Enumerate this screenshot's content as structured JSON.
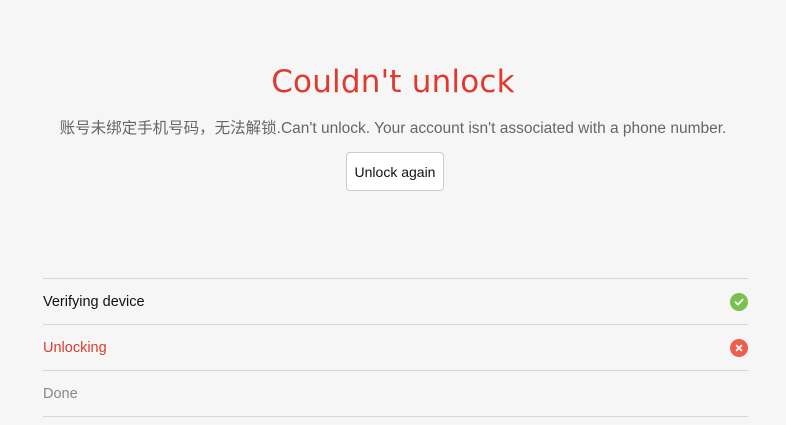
{
  "title": "Couldn't unlock",
  "message": "账号未绑定手机号码，无法解锁.Can't unlock. Your account isn't associated with a phone number.",
  "unlock_again_label": "Unlock again",
  "steps": [
    {
      "label": "Verifying device",
      "status": "success",
      "icon": "check-circle-icon"
    },
    {
      "label": "Unlocking",
      "status": "error",
      "icon": "close-circle-icon"
    },
    {
      "label": "Done",
      "status": "pending",
      "icon": ""
    }
  ],
  "colors": {
    "error": "#e03a2f",
    "success": "#7bc04e",
    "error_icon": "#ec5f4c",
    "muted": "#888888"
  }
}
